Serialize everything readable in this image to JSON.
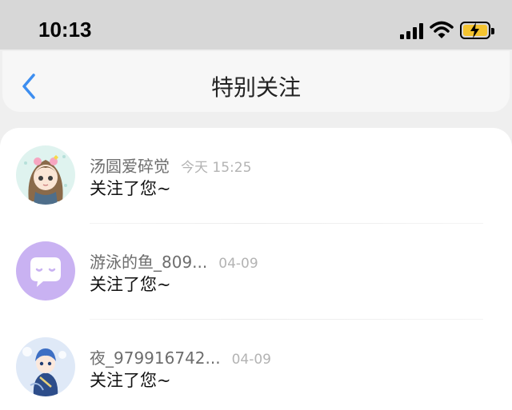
{
  "status_bar": {
    "time": "10:13"
  },
  "nav": {
    "title": "特别关注"
  },
  "items": [
    {
      "name": "汤圆爱碎觉",
      "time": "今天 15:25",
      "message": "关注了您~"
    },
    {
      "name": "游泳的鱼_809...",
      "time": "04-09",
      "message": "关注了您~"
    },
    {
      "name": "夜_979916742...",
      "time": "04-09",
      "message": "关注了您~"
    }
  ],
  "colors": {
    "accent": "#3d8ef0",
    "avatar_purple": "#c9b2f2",
    "battery": "#f4c430"
  }
}
